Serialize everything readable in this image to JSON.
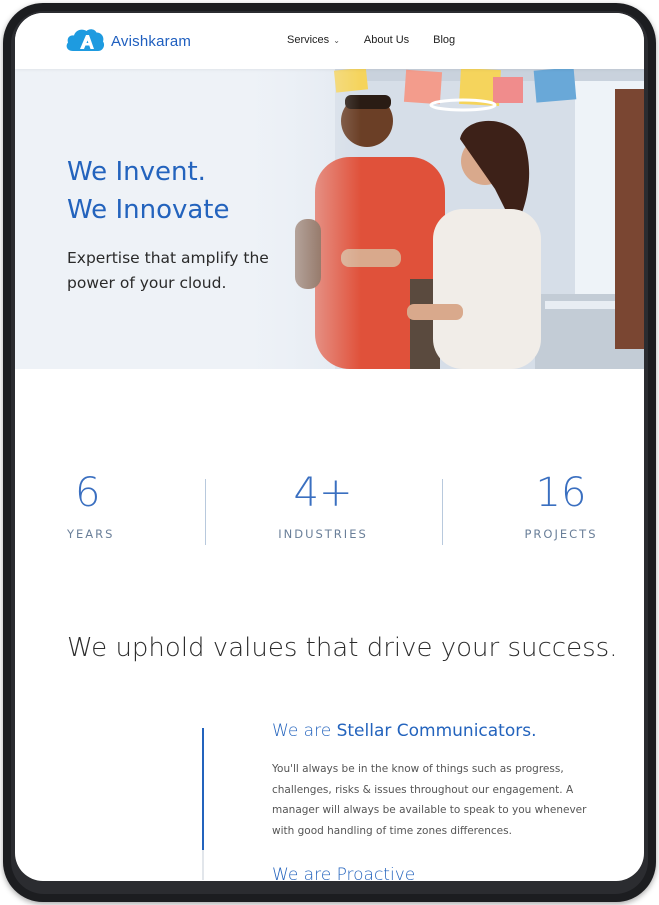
{
  "brand": {
    "name": "Avishkaram",
    "color": "#2363bd"
  },
  "nav": {
    "services": "Services",
    "about": "About Us",
    "blog": "Blog"
  },
  "hero": {
    "title_line1": "We Invent.",
    "title_line2": "We Innovate",
    "subtitle": "Expertise that amplify the power of your cloud."
  },
  "stats": [
    {
      "number": "6",
      "label": "YEARS"
    },
    {
      "number": "4+",
      "label": "INDUSTRIES"
    },
    {
      "number": "16",
      "label": "PROJECTS"
    }
  ],
  "values": {
    "title": "We uphold values that drive your success.",
    "items": [
      {
        "prefix": "We are ",
        "highlight": "Stellar Communicators.",
        "text": "You'll always be in the know of things such as progress, challenges, risks & issues throughout our engagement. A manager will always be available to speak to you whenever with good handling of time zones differences."
      },
      {
        "prefix": "We are ",
        "highlight": "Proactive"
      }
    ]
  }
}
